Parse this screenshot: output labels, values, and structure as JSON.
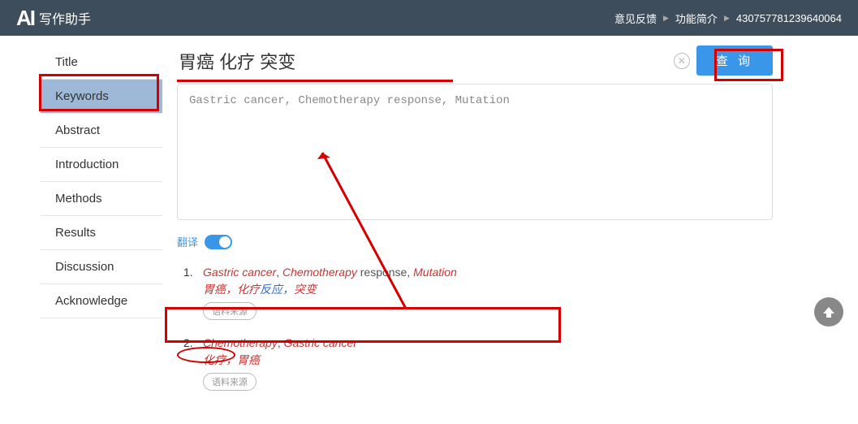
{
  "header": {
    "logo_icon": "AI",
    "logo_text": "写作助手",
    "links": {
      "feedback": "意见反馈",
      "features": "功能简介",
      "userid": "430757781239640064"
    }
  },
  "sidebar": {
    "items": [
      {
        "label": "Title"
      },
      {
        "label": "Keywords"
      },
      {
        "label": "Abstract"
      },
      {
        "label": "Introduction"
      },
      {
        "label": "Methods"
      },
      {
        "label": "Results"
      },
      {
        "label": "Discussion"
      },
      {
        "label": "Acknowledge"
      }
    ],
    "active_index": 1
  },
  "search": {
    "value": "胃癌 化疗 突变",
    "button_label": "查 询",
    "clear_symbol": "✕"
  },
  "output": {
    "text": "Gastric cancer, Chemotherapy response, Mutation"
  },
  "translate": {
    "label": "翻译",
    "on": true
  },
  "results": [
    {
      "num": "1.",
      "en_parts": [
        {
          "t": "Gastric cancer",
          "hl": true
        },
        {
          "t": ", ",
          "hl": false
        },
        {
          "t": "Chemotherapy",
          "hl": true
        },
        {
          "t": " response, ",
          "hl": false
        },
        {
          "t": "Mutation",
          "hl": true
        }
      ],
      "zh_parts": [
        {
          "t": "胃癌，化疗",
          "hl": true
        },
        {
          "t": "反应，",
          "hl": false
        },
        {
          "t": "突变",
          "hl": true
        }
      ],
      "source_label": "语料来源"
    },
    {
      "num": "2.",
      "en_parts": [
        {
          "t": "Chemotherapy",
          "hl": true
        },
        {
          "t": ", ",
          "hl": false
        },
        {
          "t": "Gastric cancer",
          "hl": true
        }
      ],
      "zh_parts": [
        {
          "t": "化疗，胃癌",
          "hl": true
        }
      ],
      "source_label": "语料来源"
    }
  ]
}
